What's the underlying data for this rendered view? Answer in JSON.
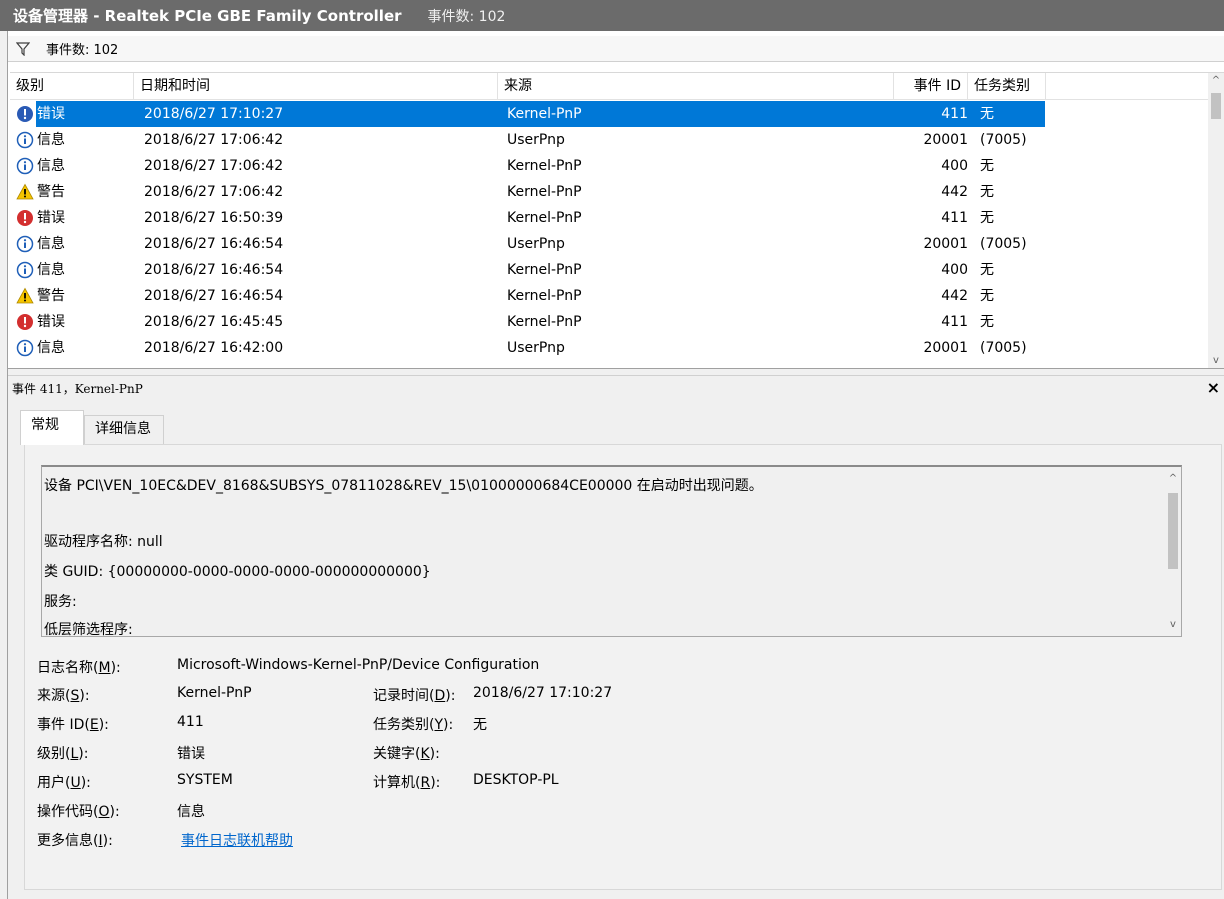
{
  "window": {
    "title": "设备管理器 - Realtek PCIe GBE Family Controller",
    "event_count_title": "事件数: 102"
  },
  "filterbar": {
    "icon": "filter-icon",
    "label": "事件数: 102"
  },
  "table": {
    "columns": {
      "level": "级别",
      "datetime": "日期和时间",
      "source": "来源",
      "event_id": "事件 ID",
      "task": "任务类别"
    },
    "rows": [
      {
        "icon": "error-info-icon",
        "level": "错误",
        "datetime": "2018/6/27 17:10:27",
        "source": "Kernel-PnP",
        "event_id": "411",
        "task": "无",
        "selected": true
      },
      {
        "icon": "info-icon",
        "level": "信息",
        "datetime": "2018/6/27 17:06:42",
        "source": "UserPnp",
        "event_id": "20001",
        "task": "(7005)"
      },
      {
        "icon": "info-icon",
        "level": "信息",
        "datetime": "2018/6/27 17:06:42",
        "source": "Kernel-PnP",
        "event_id": "400",
        "task": "无"
      },
      {
        "icon": "warning-icon",
        "level": "警告",
        "datetime": "2018/6/27 17:06:42",
        "source": "Kernel-PnP",
        "event_id": "442",
        "task": "无"
      },
      {
        "icon": "error-icon",
        "level": "错误",
        "datetime": "2018/6/27 16:50:39",
        "source": "Kernel-PnP",
        "event_id": "411",
        "task": "无"
      },
      {
        "icon": "info-icon",
        "level": "信息",
        "datetime": "2018/6/27 16:46:54",
        "source": "UserPnp",
        "event_id": "20001",
        "task": "(7005)"
      },
      {
        "icon": "info-icon",
        "level": "信息",
        "datetime": "2018/6/27 16:46:54",
        "source": "Kernel-PnP",
        "event_id": "400",
        "task": "无"
      },
      {
        "icon": "warning-icon",
        "level": "警告",
        "datetime": "2018/6/27 16:46:54",
        "source": "Kernel-PnP",
        "event_id": "442",
        "task": "无"
      },
      {
        "icon": "error-icon",
        "level": "错误",
        "datetime": "2018/6/27 16:45:45",
        "source": "Kernel-PnP",
        "event_id": "411",
        "task": "无"
      },
      {
        "icon": "info-icon",
        "level": "信息",
        "datetime": "2018/6/27 16:42:00",
        "source": "UserPnp",
        "event_id": "20001",
        "task": "(7005)"
      }
    ]
  },
  "detail": {
    "title": "事件 411，Kernel-PnP",
    "close_label": "×",
    "tabs": {
      "general": "常规",
      "details": "详细信息"
    },
    "description": {
      "line1": "设备 PCI\\VEN_10EC&DEV_8168&SUBSYS_07811028&REV_15\\01000000684CE00000 在启动时出现问题。",
      "line2": "驱动程序名称: null",
      "line3": "类 GUID: {00000000-0000-0000-0000-000000000000}",
      "line4": "服务:",
      "line5": "低层筛选程序:"
    },
    "props": {
      "log_name_label_pre": "日志名称(",
      "log_name_key": "M",
      "log_name_label_post": "):",
      "log_name_value": "Microsoft-Windows-Kernel-PnP/Device Configuration",
      "source_label_pre": "来源(",
      "source_key": "S",
      "source_label_post": "):",
      "source_value": "Kernel-PnP",
      "logged_label_pre": "记录时间(",
      "logged_key": "D",
      "logged_label_post": "):",
      "logged_value": "2018/6/27 17:10:27",
      "event_id_label_pre": "事件 ID(",
      "event_id_key": "E",
      "event_id_label_post": "):",
      "event_id_value": "411",
      "task_label_pre": "任务类别(",
      "task_key": "Y",
      "task_label_post": "):",
      "task_value": "无",
      "level_label_pre": "级别(",
      "level_key": "L",
      "level_label_post": "):",
      "level_value": "错误",
      "keywords_label_pre": "关键字(",
      "keywords_key": "K",
      "keywords_label_post": "):",
      "user_label_pre": "用户(",
      "user_key": "U",
      "user_label_post": "):",
      "user_value": "SYSTEM",
      "computer_label_pre": "计算机(",
      "computer_key": "R",
      "computer_label_post": "):",
      "computer_value": "DESKTOP-PL",
      "opcode_label_pre": "操作代码(",
      "opcode_key": "O",
      "opcode_label_post": "):",
      "opcode_value": "信息",
      "moreinfo_label_pre": "更多信息(",
      "moreinfo_key": "I",
      "moreinfo_label_post": "):",
      "moreinfo_link": "事件日志联机帮助"
    }
  },
  "colors": {
    "selection": "#0078d7",
    "titlebar": "#6b6b6b",
    "error": "#d32f2f",
    "info_selected": "#2a5ab5",
    "info": "#1f5fb8",
    "warning": "#f5c400",
    "link": "#0066cc"
  }
}
